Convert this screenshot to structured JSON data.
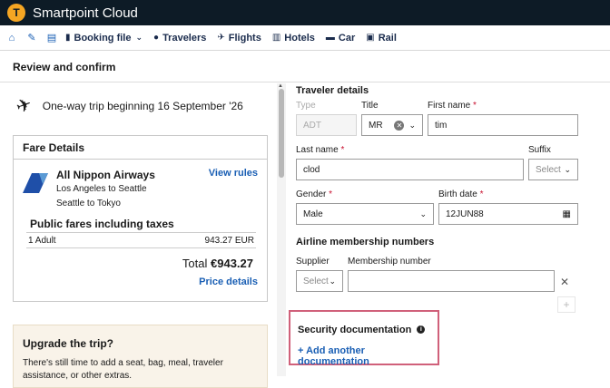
{
  "app": {
    "title": "Smartpoint Cloud",
    "logo_icon": "smartpoint-logo-icon"
  },
  "nav": {
    "booking_file": "Booking file",
    "travelers": "Travelers",
    "flights": "Flights",
    "hotels": "Hotels",
    "car": "Car",
    "rail": "Rail"
  },
  "page": {
    "section_title": "Review and confirm"
  },
  "trip": {
    "summary": "One-way trip beginning 16 September '26"
  },
  "fare": {
    "heading": "Fare Details",
    "airline": "All Nippon Airways",
    "route_line1": "Los Angeles to Seattle",
    "route_line2": "Seattle to Tokyo",
    "view_rules": "View rules",
    "public_fares": "Public fares including taxes",
    "passenger": "1 Adult",
    "passenger_price": "943.27 EUR",
    "total_label": "Total",
    "total_value": "€943.27",
    "price_details": "Price details"
  },
  "upgrade": {
    "title": "Upgrade the trip?",
    "text": "There's still time to add a seat, bag, meal, traveler assistance, or other extras."
  },
  "traveler": {
    "heading": "Traveler details",
    "type_label": "Type",
    "type_value": "ADT",
    "title_label": "Title",
    "title_value": "MR",
    "first_name_label": "First name",
    "first_name_value": "tim",
    "last_name_label": "Last name",
    "last_name_value": "clod",
    "suffix_label": "Suffix",
    "suffix_value": "Select",
    "gender_label": "Gender",
    "gender_value": "Male",
    "birth_label": "Birth date",
    "birth_value": "12JUN88",
    "required_mark": "*"
  },
  "membership": {
    "heading": "Airline membership numbers",
    "supplier_label": "Supplier",
    "supplier_value": "Select",
    "number_label": "Membership number",
    "number_value": ""
  },
  "security": {
    "heading": "Security documentation",
    "add_link": "Add another documentation"
  },
  "colors": {
    "accent": "#1a5fb4",
    "required": "#c8102e",
    "topbar": "#0d1b26",
    "highlight_border": "#d0607a"
  }
}
